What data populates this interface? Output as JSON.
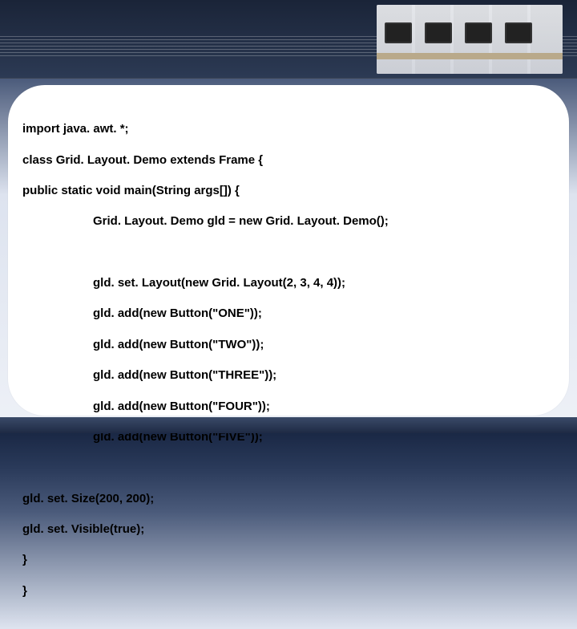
{
  "code": {
    "l1": "import java. awt. *;",
    "l2": "class Grid. Layout. Demo extends Frame {",
    "l3": "public static void main(String args[]) {",
    "l4": "Grid. Layout. Demo gld = new Grid. Layout. Demo();",
    "l5": "gld. set. Layout(new Grid. Layout(2, 3, 4, 4));",
    "l6": "gld. add(new Button(\"ONE\"));",
    "l7": "gld. add(new Button(\"TWO\"));",
    "l8": "gld. add(new Button(\"THREE\"));",
    "l9": "gld. add(new Button(\"FOUR\"));",
    "l10": "gld. add(new Button(\"FIVE\"));",
    "l11": "gld. set. Size(200, 200);",
    "l12": "gld. set. Visible(true);",
    "l13": "}",
    "l14": "}"
  }
}
